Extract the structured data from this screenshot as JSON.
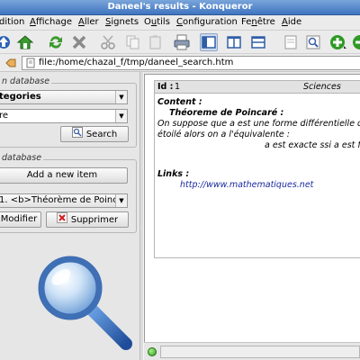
{
  "window": {
    "title": "Daneel's results - Konqueror"
  },
  "menu": {
    "items": [
      {
        "pre": "",
        "acc": "",
        "post": "dition"
      },
      {
        "pre": "",
        "acc": "A",
        "post": "ffichage"
      },
      {
        "pre": "",
        "acc": "A",
        "post": "ller"
      },
      {
        "pre": "",
        "acc": "S",
        "post": "ignets"
      },
      {
        "pre": "O",
        "acc": "u",
        "post": "tils"
      },
      {
        "pre": "",
        "acc": "C",
        "post": "onfiguration"
      },
      {
        "pre": "Fe",
        "acc": "n",
        "post": "être"
      },
      {
        "pre": "",
        "acc": "A",
        "post": "ide"
      }
    ]
  },
  "toolbar": {
    "icons": [
      "up-arrow-icon",
      "home-icon",
      "reload-icon",
      "stop-icon",
      "cut-icon",
      "copy-icon",
      "paste-icon",
      "print-icon",
      "view-split-left-icon",
      "view-split-vertical-icon",
      "view-split-horizontal-icon",
      "preview-icon",
      "find-icon",
      "zoom-in-icon",
      "zoom-out-icon"
    ]
  },
  "location": {
    "url": "file:/home/chazal_f/tmp/daneel_search.htm"
  },
  "search_panel": {
    "group_label": "n database",
    "category_value": "tegories",
    "query_value": "re",
    "search_label": "Search"
  },
  "db_panel": {
    "group_label": "database",
    "add_label": "Add a new item",
    "item_value": "1. <b>Théorème de Poinca",
    "modify_label": "Modifier",
    "delete_label": "Supprimer"
  },
  "result": {
    "id_label": "Id :",
    "id_value": "1",
    "category": "Sciences",
    "content_label": "Content :",
    "heading": "Théoreme de Poincaré :",
    "line1": "On suppose que a est une forme différentielle de",
    "line2": "étoilé alors on a l'équivalente :",
    "line3": "a est exacte ssi a est fer",
    "links_label": "Links :",
    "link": "http://www.mathematiques.net"
  },
  "colors": {
    "titlebar": "#3f74c0",
    "link": "#1a2a9e",
    "status_led": "#2e9a1a"
  }
}
